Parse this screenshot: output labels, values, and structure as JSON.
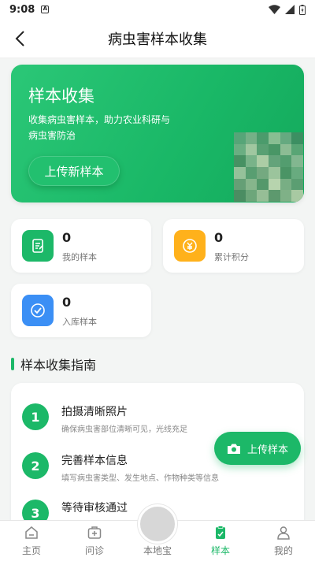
{
  "status_bar": {
    "time": "9:08",
    "sim_label": "A"
  },
  "header": {
    "title": "病虫害样本收集"
  },
  "hero": {
    "title": "样本收集",
    "description": "收集病虫害样本，助力农业科研与病虫害防治",
    "button_label": "上传新样本"
  },
  "stats": [
    {
      "value": "0",
      "label": "我的样本",
      "icon": "document-icon",
      "color": "#1cb868"
    },
    {
      "value": "0",
      "label": "累计积分",
      "icon": "coin-icon",
      "color": "#ffb11b"
    },
    {
      "value": "0",
      "label": "入库样本",
      "icon": "check-circle-icon",
      "color": "#3b8ff5"
    }
  ],
  "guide": {
    "title": "样本收集指南",
    "steps": [
      {
        "num": "1",
        "title": "拍摄清晰照片",
        "desc": "确保病虫害部位清晰可见，光线充足"
      },
      {
        "num": "2",
        "title": "完善样本信息",
        "desc": "填写病虫害类型、发生地点、作物种类等信息"
      },
      {
        "num": "3",
        "title": "等待审核通过",
        "desc": ""
      }
    ]
  },
  "fab": {
    "label": "上传样本",
    "icon": "camera-icon"
  },
  "tabbar": {
    "items": [
      {
        "label": "主页",
        "icon": "home-icon"
      },
      {
        "label": "问诊",
        "icon": "medical-kit-icon"
      },
      {
        "label": "本地宝",
        "icon": "center-icon"
      },
      {
        "label": "样本",
        "icon": "sample-tube-icon"
      },
      {
        "label": "我的",
        "icon": "person-icon"
      }
    ],
    "active_index": 3
  },
  "colors": {
    "primary": "#1cb868",
    "orange": "#ffb11b",
    "blue": "#3b8ff5"
  }
}
